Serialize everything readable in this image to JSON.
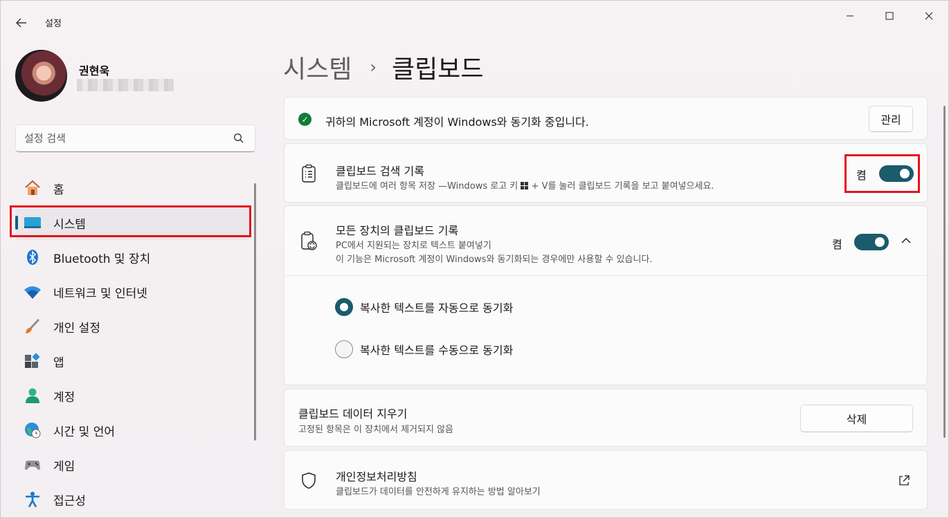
{
  "window": {
    "title": "설정",
    "controls": {
      "minimize": "—",
      "maximize": "☐",
      "close": "✕"
    }
  },
  "profile": {
    "name": "권현욱"
  },
  "search": {
    "placeholder": "설정 검색"
  },
  "nav": {
    "items": [
      {
        "label": "홈",
        "icon": "home-icon"
      },
      {
        "label": "시스템",
        "icon": "system-icon",
        "active": true
      },
      {
        "label": "Bluetooth 및 장치",
        "icon": "bluetooth-icon"
      },
      {
        "label": "네트워크 및 인터넷",
        "icon": "wifi-icon"
      },
      {
        "label": "개인 설정",
        "icon": "brush-icon"
      },
      {
        "label": "앱",
        "icon": "apps-icon"
      },
      {
        "label": "계정",
        "icon": "account-icon"
      },
      {
        "label": "시간 및 언어",
        "icon": "globe-clock-icon"
      },
      {
        "label": "게임",
        "icon": "gamepad-icon"
      },
      {
        "label": "접근성",
        "icon": "accessibility-icon"
      }
    ]
  },
  "header": {
    "parent": "시스템",
    "separator": "›",
    "current": "클립보드"
  },
  "sync_banner": {
    "text": "귀하의 Microsoft 계정이 Windows와 동기화 중입니다.",
    "button": "관리"
  },
  "clipboard_history": {
    "title": "클립보드 검색 기록",
    "subtitle_before": "클립보드에 여러 항목 저장 —Windows 로고 키 ",
    "subtitle_after": " + V를 눌러 클립보드 기록을 보고 붙여넣으세요.",
    "state_label": "켬",
    "on": true
  },
  "sync_devices": {
    "title": "모든 장치의 클립보드 기록",
    "subtitle1": "PC에서 지원되는 장치로 텍스트 붙여넣기",
    "subtitle2": "이 기능은 Microsoft 계정이 Windows와 동기화되는 경우에만 사용할 수 있습니다.",
    "state_label": "켬",
    "on": true,
    "options": [
      {
        "label": "복사한 텍스트를 자동으로 동기화",
        "checked": true
      },
      {
        "label": "복사한 텍스트를 수동으로 동기화",
        "checked": false
      }
    ]
  },
  "clear_data": {
    "title": "클립보드 데이터 지우기",
    "subtitle": "고정된 항목은 이 장치에서 제거되지 않음",
    "button": "삭제"
  },
  "privacy": {
    "title": "개인정보처리방침",
    "subtitle": "클립보드가 데이터를 안전하게 유지하는 방법 알아보기"
  },
  "colors": {
    "accent": "#1a5b6c",
    "highlight": "#e3131b",
    "success": "#117c3c"
  }
}
